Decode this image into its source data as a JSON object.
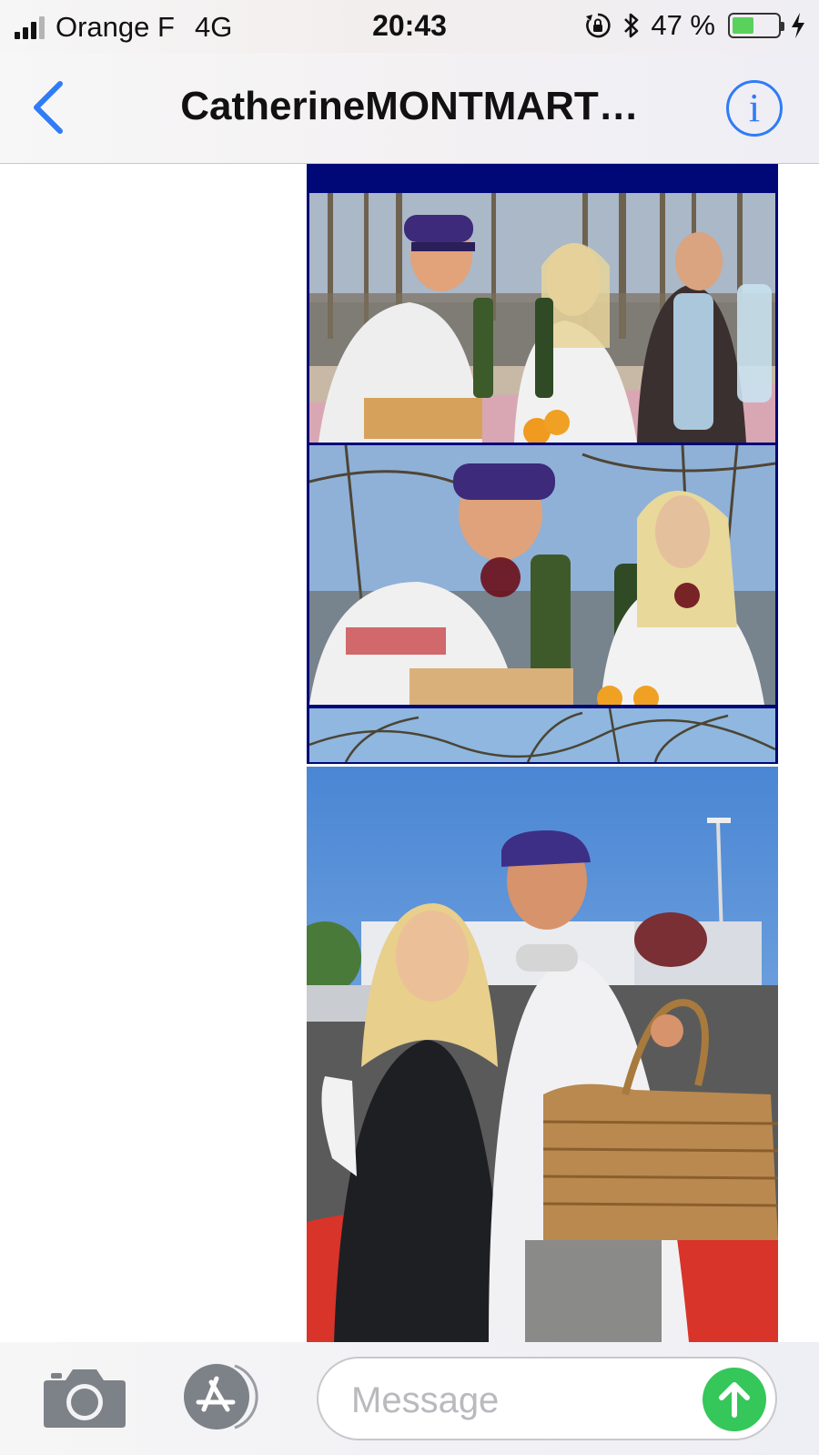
{
  "status_bar": {
    "carrier": "Orange F",
    "network": "4G",
    "time": "20:43",
    "battery_percent_label": "47 %",
    "battery_level": 0.47,
    "icons": [
      "signal-icon",
      "rotation-lock-icon",
      "bluetooth-icon",
      "battery-icon",
      "charging-bolt-icon"
    ]
  },
  "nav": {
    "title": "CatherineMONTMART…",
    "back_icon": "chevron-left-icon",
    "info_label": "i",
    "accent": "#2f7cf6"
  },
  "thread": {
    "attachments": [
      {
        "kind": "photo-collage",
        "frame_color": "#000877",
        "photos": 3
      },
      {
        "kind": "photo"
      }
    ]
  },
  "input_bar": {
    "camera_icon": "camera-icon",
    "apps_icon": "app-store-icon",
    "placeholder": "Message",
    "send_icon": "arrow-up-icon",
    "send_color": "#35c759"
  }
}
